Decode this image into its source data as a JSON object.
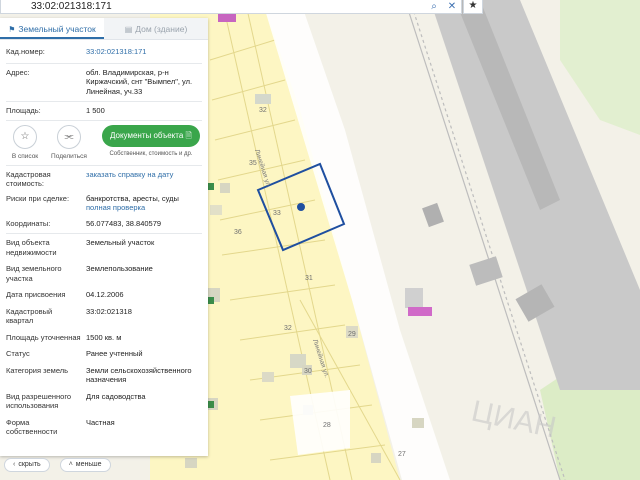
{
  "search": {
    "query": "33:02:021318:171",
    "search_icon": "search-icon",
    "close_icon": "close-icon"
  },
  "fav_icon": "star-icon",
  "tabs": [
    {
      "label": "Земельный участок",
      "icon": "parcel-icon"
    },
    {
      "label": "Дом (здание)",
      "icon": "building-icon"
    }
  ],
  "info": {
    "cadnum": {
      "label": "Кад.номер:",
      "value": "33:02:021318:171"
    },
    "address": {
      "label": "Адрес:",
      "lines": [
        "обл. Владимирская, р-н",
        "Киржачский, снт \"Вымпел\", ул.",
        "Линейная, уч.33"
      ]
    },
    "area": {
      "label": "Площадь:",
      "value": "1 500"
    }
  },
  "actions": {
    "add_list": "В список",
    "share": "Поделиться",
    "docs_button": "Документы объекта",
    "docs_sub": "Собственник, стоимость и др."
  },
  "details": {
    "cad_cost": {
      "label_lines": [
        "Кадастровая",
        "стоимость:"
      ],
      "value": "заказать справку на дату"
    },
    "risks": {
      "label": "Риски при сделке:",
      "value": "банкротства, аресты, суды",
      "link": "полная проверка"
    },
    "coords": {
      "label": "Координаты:",
      "value": "56.077483, 38.840579"
    }
  },
  "attributes": [
    {
      "label_lines": [
        "Вид объекта",
        "недвижимости"
      ],
      "value_lines": [
        "Земельный участок"
      ]
    },
    {
      "label_lines": [
        "Вид земельного",
        "участка"
      ],
      "value_lines": [
        "Землепользование"
      ]
    },
    {
      "label_lines": [
        "Дата присвоения"
      ],
      "value_lines": [
        "04.12.2006"
      ]
    },
    {
      "label_lines": [
        "Кадастровый",
        "квартал"
      ],
      "value_lines": [
        "33:02:021318"
      ]
    },
    {
      "label_lines": [
        "Площадь уточненная"
      ],
      "value_lines": [
        "1500 кв. м"
      ]
    },
    {
      "label_lines": [
        "Статус"
      ],
      "value_lines": [
        "Ранее учтенный"
      ]
    },
    {
      "label_lines": [
        "Категория земель"
      ],
      "value_lines": [
        "Земли сельскохозяйственного",
        "назначения"
      ]
    },
    {
      "label_lines": [
        "Вид разрешенного",
        "использования"
      ],
      "value_lines": [
        "Для садоводства"
      ]
    },
    {
      "label_lines": [
        "Форма",
        "собственности"
      ],
      "value_lines": [
        "Частная"
      ]
    }
  ],
  "bottom": {
    "hide": "скрыть",
    "less": "меньше"
  },
  "map": {
    "parcel_labels": [
      "32",
      "35",
      "33",
      "36",
      "31",
      "32",
      "30",
      "29",
      "28",
      "27"
    ],
    "street_labels": [
      "Линейная ул.",
      "Линейная ул."
    ],
    "watermark": "ЦИАН",
    "colors": {
      "parcel_fill": "#fff7b8",
      "parcel_line": "#e0d48a",
      "highlight": "#1f4fa0",
      "railway": "#b4b4b4",
      "green": "#dfeecd"
    }
  }
}
